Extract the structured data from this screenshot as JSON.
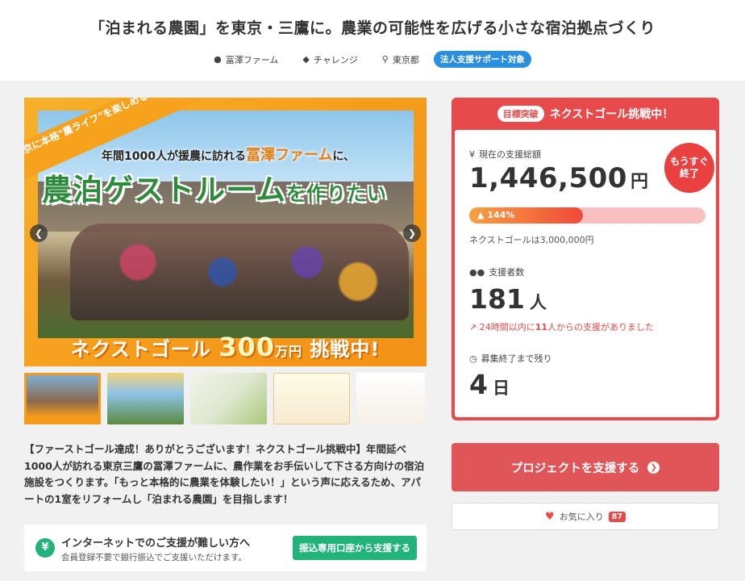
{
  "project": {
    "title": "「泊まれる農園」を東京・三鷹に。農業の可能性を広げる小さな宿泊拠点づくり",
    "owner": "冨澤ファーム",
    "category": "チャレンジ",
    "location": "東京都",
    "badge": "法人支援サポート対象"
  },
  "hero": {
    "corner_text": "東京に本格\"農ライフ\"を楽しめる場所を！",
    "sub_prefix": "年間1000人が援農に訪れる",
    "sub_farm": "冨澤ファーム",
    "sub_suffix": "に、",
    "main_text": "農泊ゲストルーム",
    "main_suffix": "を作りたい",
    "bottom_prefix": "ネクストゴール",
    "bottom_num": "300",
    "bottom_unit": "万円",
    "bottom_suffix": "挑戦中!"
  },
  "description": "【ファーストゴール達成！ありがとうございます！ネクストゴール挑戦中】年間延べ1000人が訪れる東京三鷹の冨澤ファームに、農作業をお手伝いして下さる方向けの宿泊施設をつくります。「もっと本格的に農業を体験したい！」という声に応えるため、アパートの1室をリフォームし「泊まれる農園」を目指します！",
  "bank": {
    "title": "インターネットでのご支援が難しい方へ",
    "sub": "会員登録不要で銀行振込でご支援いただけます。",
    "button": "振込専用口座から支援する",
    "icon": "¥"
  },
  "card": {
    "tag": "目標突破",
    "head": "ネクストゴール挑戦中！",
    "amount_label": "現在の支援総額",
    "amount": "1,446,500",
    "amount_unit": "円",
    "soon_line1": "もうすぐ",
    "soon_line2": "終了",
    "progress_percent": 144,
    "progress_label": "144%",
    "next_goal": "ネクストゴールは3,000,000円",
    "backers_label": "支援者数",
    "backers": "181",
    "backers_unit": "人",
    "trend_prefix": "24時間以内に",
    "trend_count": "11",
    "trend_suffix": "人からの支援がありました",
    "remain_label": "募集終了まで残り",
    "remain": "4",
    "remain_unit": "日"
  },
  "actions": {
    "support_button": "プロジェクトを支援する",
    "favorite_label": "お気に入り",
    "favorite_count": "87"
  },
  "colors": {
    "accent": "#e74a4a",
    "green": "#22b37a",
    "badge_blue": "#2b8fe0",
    "orange": "#f59b1b"
  }
}
